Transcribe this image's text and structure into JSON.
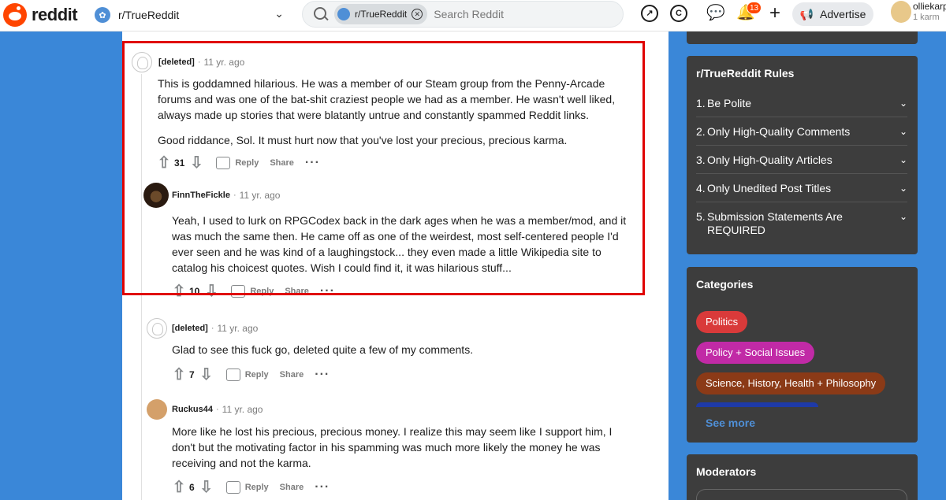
{
  "header": {
    "logo_text": "reddit",
    "subreddit": "r/TrueReddit",
    "search_chip": "r/TrueReddit",
    "search_placeholder": "Search Reddit",
    "notification_count": "13",
    "advertise_label": "Advertise",
    "username": "olliekarp",
    "karma": "1 karm"
  },
  "comments": [
    {
      "author": "[deleted]",
      "time": "11 yr. ago",
      "paragraphs": [
        "This is goddamned hilarious. He was a member of our Steam group from the Penny-Arcade forums and was one of the bat-shit craziest people we had as a member. He wasn't well liked, always made up stories that were blatantly untrue and constantly spammed Reddit links.",
        "Good riddance, Sol. It must hurt now that you've lost your precious, precious karma."
      ],
      "score": "31",
      "reply_label": "Reply",
      "share_label": "Share"
    },
    {
      "author": "FinnTheFickle",
      "time": "11 yr. ago",
      "paragraphs": [
        "Yeah, I used to lurk on RPGCodex back in the dark ages when he was a member/mod, and it was much the same then. He came off as one of the weirdest, most self-centered people I'd ever seen and he was kind of a laughingstock... they even made a little Wikipedia site to catalog his choicest quotes. Wish I could find it, it was hilarious stuff..."
      ],
      "score": "10",
      "reply_label": "Reply",
      "share_label": "Share"
    },
    {
      "author": "[deleted]",
      "time": "11 yr. ago",
      "paragraphs": [
        "Glad to see this fuck go, deleted quite a few of my comments."
      ],
      "score": "7",
      "reply_label": "Reply",
      "share_label": "Share"
    },
    {
      "author": "Ruckus44",
      "time": "11 yr. ago",
      "paragraphs": [
        "More like he lost his precious, precious money. I realize this may seem like I support him, I don't but the motivating factor in his spamming was much more likely the money he was receiving and not the karma."
      ],
      "score": "6",
      "reply_label": "Reply",
      "share_label": "Share"
    }
  ],
  "rules_panel": {
    "title": "r/TrueReddit Rules",
    "rules": [
      {
        "num": "1.",
        "text": "Be Polite"
      },
      {
        "num": "2.",
        "text": "Only High-Quality Comments"
      },
      {
        "num": "3.",
        "text": "Only High-Quality Articles"
      },
      {
        "num": "4.",
        "text": "Only Unedited Post Titles"
      },
      {
        "num": "5.",
        "text": "Submission Statements Are REQUIRED"
      }
    ]
  },
  "categories_panel": {
    "title": "Categories",
    "items": [
      {
        "label": "Politics",
        "color": "#d93a3a"
      },
      {
        "label": "Policy + Social Issues",
        "color": "#c12aa6"
      },
      {
        "label": "Science, History, Health + Philosophy",
        "color": "#8b3a17"
      }
    ],
    "see_more": "See more"
  },
  "moderators_panel": {
    "title": "Moderators"
  },
  "colors": {
    "brand": "#ff4500",
    "highlight": "#e00000",
    "background": "#3a87d8",
    "panel": "#3d3d3d"
  }
}
